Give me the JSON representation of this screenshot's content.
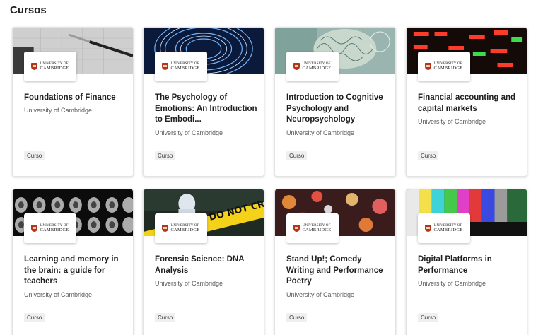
{
  "section": {
    "title": "Cursos"
  },
  "logo": {
    "line1": "UNIVERSITY OF",
    "line2": "CAMBRIDGE"
  },
  "colors": {
    "brand_red": "#b3341f",
    "badge_bg": "#efefef"
  },
  "courses": [
    {
      "title": "Foundations of Finance",
      "partner": "University of Cambridge",
      "type": "Curso",
      "image": "pen-and-paper"
    },
    {
      "title": "The Psychology of Emotions: An Introduction to Embodi...",
      "partner": "University of Cambridge",
      "type": "Curso",
      "image": "blue-abstract-rings"
    },
    {
      "title": "Introduction to Cognitive Psychology and Neuropsychology",
      "partner": "University of Cambridge",
      "type": "Curso",
      "image": "brain-illustration"
    },
    {
      "title": "Financial accounting and capital markets",
      "partner": "University of Cambridge",
      "type": "Curso",
      "image": "stock-ticker-board"
    },
    {
      "title": "Learning and memory in the brain: a guide for teachers",
      "partner": "University of Cambridge",
      "type": "Curso",
      "image": "brain-scans"
    },
    {
      "title": "Forensic Science: DNA Analysis",
      "partner": "University of Cambridge",
      "type": "Curso",
      "image": "crime-scene-tape",
      "tape_text": "DO NOT CROSS"
    },
    {
      "title": "Stand Up!; Comedy Writing and Performance Poetry",
      "partner": "University of Cambridge",
      "type": "Curso",
      "image": "stage-lights"
    },
    {
      "title": "Digital Platforms in Performance",
      "partner": "University of Cambridge",
      "type": "Curso",
      "image": "color-bars"
    }
  ]
}
